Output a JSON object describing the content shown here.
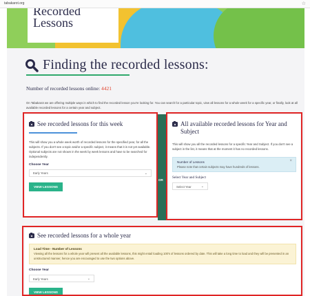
{
  "browser": {
    "url": "tabakarot.org",
    "bookmark_icon": "star-icon"
  },
  "hero": {
    "title_line1": "Recorded",
    "title_line2": "Lessons"
  },
  "page": {
    "heading": "Finding the recorded lessons:",
    "heading_icon": "search-icon",
    "count_label": "Number of recorded lessons online:",
    "count_value": "4421",
    "intro": "On Tabakarot we are offering multiple ways in which to find the recorded lesson you're looking for. You can search for a particular topic, view all lessons for a whole week for a specific year, or finally, look at all available recorded lessons for a certain year and subject."
  },
  "week_panel": {
    "title": "See recorded lessons for this week",
    "description": "This will show you a whole week worth of recorded lessons for the specified year, for all the subjects. If you don't see a topic and/or a specific subject, it means that it is not yet available. Optional subjects are not shown in the week by week lessons and have to be searched for independently.",
    "year_label": "Choose Year",
    "year_value": "Early Years",
    "button": "View Lessons"
  },
  "divider": {
    "or": "OR"
  },
  "subject_panel": {
    "title": "All available recorded lessons for Year and Subject",
    "description": "This will show you all the recorded lessons for a specific Year and Subject. If you don't see a subject in the list, it means that at the moment it has no recorded lessons.",
    "info_title": "Number of Lessons",
    "info_body": "Please note that certain subjects may have hundreds of lessons.",
    "select_label": "Select Year and Subject",
    "year_value": "Select Year"
  },
  "year_panel": {
    "title": "See recorded lessons for a whole year",
    "warn_title": "Load Time - Number of Lessons",
    "warn_body": "Viewing all the lessons for a whole year will present all the available lessons, this might entail loading 100's of lessons ordered by date. This will take a long time to load and they will be presented in an unstructured manner, hence you are encouraged to use the two options above.",
    "year_label": "Choose Year",
    "year_value": "Early Years",
    "button": "View Lessons"
  },
  "colors": {
    "accent_green": "#2ab38a",
    "annotation_red": "#e02424",
    "heading_navy": "#2b2b4a"
  }
}
